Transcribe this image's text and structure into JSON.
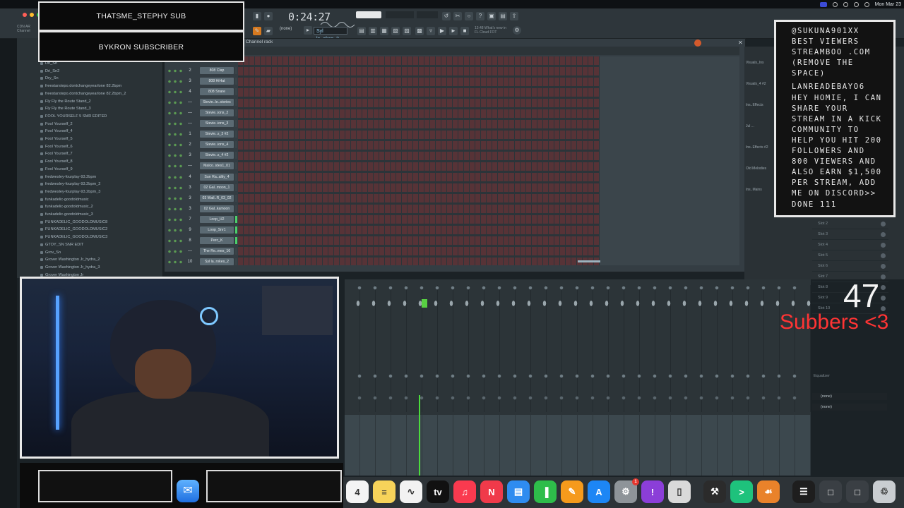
{
  "menubar": {
    "datetime": "Mon Mar 23"
  },
  "toolbar": {
    "time": "0:24:27",
    "pattern": "Syl la..okes_2",
    "mode": "(none)",
    "hint_line1": "13:48  What's new in",
    "hint_line2": "FL Cloud FOT"
  },
  "left_strip": [
    "CDN AR",
    "Channel"
  ],
  "browser": {
    "items": [
      "Dri_Sn",
      "Dri_Sn2",
      "Dry_Sn",
      "freestarstepo.dontchangeyearlone 82.2bpm",
      "freestarstepo.dontchangeyearlone 82.2bpm_2",
      "Fly Fly the Route Stand_2",
      "Fly Fly the Route Stand_3",
      "FOOL YOURSELF 5 SMR EDITED",
      "Fool Yourself_2",
      "Fool Yourself_4",
      "Fool Yourself_5",
      "Fool Yourself_6",
      "Fool Yourself_7",
      "Fool Yourself_8",
      "Fool Yourself_9",
      "fredwesley-fourplay-93.2bpm",
      "fredwesley-fourplay-93.2bpm_2",
      "fredwesley-fourplay-93.2bpm_3",
      "funkadelic-goodoldmusic",
      "funkadelic-goodoldmusic_2",
      "funkadelic-goodoldmusic_3",
      "FUNKADELIC_GOODOLDMUSIC8",
      "FUNKADELIC_GOODOLDMUSIC2",
      "FUNKADELIC_GOODOLDMUSIC3",
      "GTOY_SN SNR EDIT",
      "Grov_Sn",
      "Grover Washington Jr_hydra_2",
      "Grover Washington Jr_hydra_3",
      "Grover Washington Jr"
    ]
  },
  "rack": {
    "title": "Channel rack",
    "channels": [
      {
        "num": "2",
        "name": "808 Clap",
        "on": false
      },
      {
        "num": "3",
        "name": "808 HiHat",
        "on": false
      },
      {
        "num": "4",
        "name": "808 Snare",
        "on": false
      },
      {
        "num": "—",
        "name": "Stevie..le..stories",
        "on": false
      },
      {
        "num": "—",
        "name": "Stevie..ions_2",
        "on": false
      },
      {
        "num": "—",
        "name": "Stevie..ions_3",
        "on": false
      },
      {
        "num": "1",
        "name": "Stevie..s_3 #2",
        "on": false
      },
      {
        "num": "2",
        "name": "Stevie..ions_4",
        "on": false
      },
      {
        "num": "3",
        "name": "Stevie..s_4 #2",
        "on": false
      },
      {
        "num": "—",
        "name": "Malco..ides1_01",
        "on": false
      },
      {
        "num": "4",
        "name": "Sun Ra..ality_4",
        "on": false
      },
      {
        "num": "3",
        "name": "02 Gal..moon_1",
        "on": false
      },
      {
        "num": "3",
        "name": "03 Wall..R_03_02",
        "on": false
      },
      {
        "num": "3",
        "name": "02 Gal..kamoon",
        "on": false
      },
      {
        "num": "7",
        "name": "Loop_H2",
        "on": true
      },
      {
        "num": "9",
        "name": "Loop_Snr1",
        "on": true
      },
      {
        "num": "8",
        "name": "Perc_K",
        "on": true
      },
      {
        "num": "—",
        "name": "The Re..mes_16",
        "on": false
      },
      {
        "num": "10",
        "name": "Syl la..rokes_2",
        "on": false
      }
    ]
  },
  "mixer_right": {
    "rows": [
      "Visuals_Ins",
      "Visuals_4 #2",
      "Ins..Effects",
      "Jul ...",
      "Ins..Effects #2",
      "Old Melodies",
      "Ins..Mains"
    ],
    "slots": [
      "Slot 2",
      "Slot 3",
      "Slot 4",
      "Slot 5",
      "Slot 6",
      "Slot 7",
      "Slot 8",
      "Slot 9",
      "Slot 10"
    ],
    "eq_label": "Equalizer",
    "none1": "(none)",
    "none2": "(none)"
  },
  "overlays": {
    "banner_top": "THATSME_STEPHY SUB",
    "banner_bottom": "BYKRON SUBSCRIBER",
    "chat": [
      "@SUKUNA901XX",
      "BEST VIEWERS",
      "STREAMBOO .COM",
      "(REMOVE THE",
      "SPACE)",
      "LANREADEBAYO6",
      "HEY HOMIE, I CAN",
      "SHARE YOUR",
      "STREAM IN A KICK",
      "COMMUNITY TO",
      "HELP YOU HIT 200",
      "FOLLOWERS AND",
      "800 VIEWERS AND",
      "ALSO EARN $1,500",
      "PER STREAM, ADD",
      "ME ON DISCORD>>",
      "DONE 111"
    ],
    "sub_count": "47",
    "sub_label": "Subbers <3"
  },
  "dock": {
    "apps": [
      {
        "icon": "calendar-icon",
        "color": "#f4f4f4",
        "glyph": "4",
        "badge": ""
      },
      {
        "icon": "notes-icon",
        "color": "#f7d35a",
        "glyph": "≡",
        "badge": ""
      },
      {
        "icon": "freeform-icon",
        "color": "#f2f2f2",
        "glyph": "∿",
        "badge": ""
      },
      {
        "icon": "apple-tv-icon",
        "color": "#111111",
        "glyph": "tv",
        "badge": ""
      },
      {
        "icon": "music-icon",
        "color": "#fa3a4f",
        "glyph": "♫",
        "badge": ""
      },
      {
        "icon": "news-icon",
        "color": "#f03a4a",
        "glyph": "N",
        "badge": ""
      },
      {
        "icon": "keynote-icon",
        "color": "#2f8cf0",
        "glyph": "▤",
        "badge": ""
      },
      {
        "icon": "numbers-icon",
        "color": "#2ebd4a",
        "glyph": "▐",
        "badge": ""
      },
      {
        "icon": "pages-icon",
        "color": "#f59a1c",
        "glyph": "✎",
        "badge": ""
      },
      {
        "icon": "app-store-icon",
        "color": "#1d86f5",
        "glyph": "A",
        "badge": ""
      },
      {
        "icon": "system-settings-icon",
        "color": "#8e9499",
        "glyph": "⚙",
        "badge": "1"
      },
      {
        "icon": "feedback-icon",
        "color": "#8b3ed8",
        "glyph": "!",
        "badge": ""
      },
      {
        "icon": "simulator-icon",
        "color": "#d9d9d9",
        "glyph": "▯",
        "badge": ""
      },
      {
        "icon": "spacer-icon",
        "color": "transparent",
        "glyph": "",
        "badge": ""
      },
      {
        "icon": "instruments-icon",
        "color": "#2b2b2b",
        "glyph": "⚒",
        "badge": ""
      },
      {
        "icon": "terminal-icon",
        "color": "#1ec27c",
        "glyph": ">",
        "badge": ""
      },
      {
        "icon": "fl-studio-icon",
        "color": "#e9822a",
        "glyph": "☙",
        "badge": ""
      },
      {
        "icon": "spacer-icon",
        "color": "transparent",
        "glyph": "",
        "badge": ""
      },
      {
        "icon": "activity-monitor-icon",
        "color": "#1e1e1e",
        "glyph": "☰",
        "badge": ""
      },
      {
        "icon": "window-icon",
        "color": "#3a3f44",
        "glyph": "□",
        "badge": ""
      },
      {
        "icon": "window-icon",
        "color": "#3a3f44",
        "glyph": "□",
        "badge": ""
      },
      {
        "icon": "trash-icon",
        "color": "#c9cdd1",
        "glyph": "♲",
        "badge": ""
      }
    ],
    "mail_glyph": "✉"
  }
}
